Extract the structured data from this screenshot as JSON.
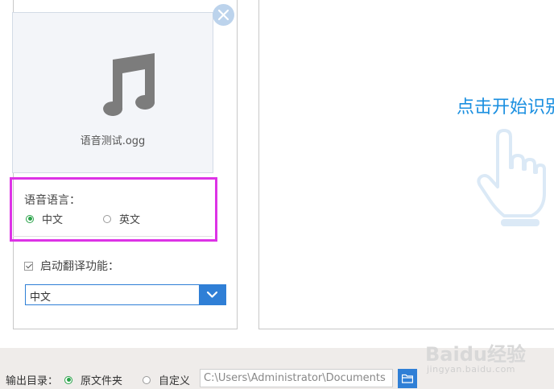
{
  "file_card": {
    "file_name": "语音测试.ogg",
    "icon": "music-note-icon"
  },
  "close_icon": "close-icon",
  "language": {
    "title": "语音语言：",
    "options": [
      {
        "label": "中文",
        "selected": true
      },
      {
        "label": "英文",
        "selected": false
      }
    ]
  },
  "translate": {
    "label": "启动翻译功能：",
    "checked": true,
    "selected_value": "中文"
  },
  "main": {
    "start_text": "点击开始识别",
    "icon": "pointing-hand-icon"
  },
  "output": {
    "label": "输出目录：",
    "options": [
      {
        "label": "原文件夹",
        "selected": true
      },
      {
        "label": "自定义",
        "selected": false
      }
    ],
    "path": "C:\\Users\\Administrator\\Documents",
    "folder_icon": "folder-icon"
  },
  "watermark": {
    "logo_text": "Baidu经验",
    "url": "jingyan.baidu.com"
  },
  "colors": {
    "accent": "#2f7fd6",
    "link": "#1a8fe0",
    "radio_selected": "#2aa34a",
    "highlight_box": "#dd33e6"
  }
}
